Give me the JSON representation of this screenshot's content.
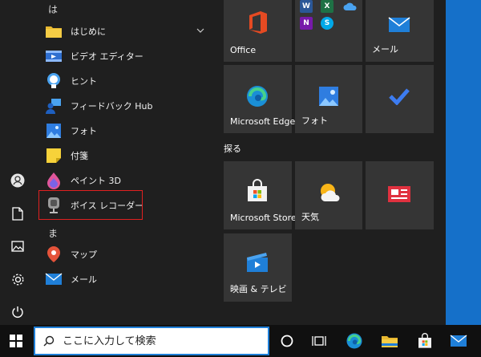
{
  "start_menu": {
    "app_list": {
      "sections": [
        {
          "letter": "は",
          "items": [
            {
              "label": "はじめに",
              "icon": "folder-icon"
            },
            {
              "label": "ビデオ エディター",
              "icon": "video-editor-icon"
            },
            {
              "label": "ヒント",
              "icon": "lightbulb-icon"
            },
            {
              "label": "フィードバック Hub",
              "icon": "feedback-hub-icon"
            },
            {
              "label": "フォト",
              "icon": "photos-icon"
            },
            {
              "label": "付箋",
              "icon": "sticky-notes-icon"
            },
            {
              "label": "ペイント 3D",
              "icon": "paint-3d-icon"
            },
            {
              "label": "ボイス レコーダー",
              "icon": "microphone-icon"
            }
          ]
        },
        {
          "letter": "ま",
          "items": [
            {
              "label": "マップ",
              "icon": "map-pin-icon"
            },
            {
              "label": "メール",
              "icon": "mail-icon"
            }
          ]
        }
      ],
      "highlighted_item": "ボイス レコーダー"
    },
    "rail": [
      "user-icon",
      "documents-icon",
      "pictures-icon",
      "settings-icon",
      "power-icon"
    ],
    "tiles": {
      "office": "Office",
      "mail": "メール",
      "edge": "Microsoft Edge",
      "photos": "フォト",
      "group_explore": "探る",
      "store": "Microsoft Store",
      "weather": "天気",
      "movies": "映画 & テレビ"
    },
    "office_mini_apps": [
      "W",
      "X",
      "N",
      "S"
    ]
  },
  "taskbar": {
    "search_placeholder": "ここに入力して検索",
    "buttons": [
      "windows-start-icon",
      "search-icon",
      "cortana-icon",
      "task-view-icon",
      "edge-icon",
      "file-explorer-icon",
      "store-icon",
      "mail-icon"
    ]
  },
  "colors": {
    "accent": "#1f7fd8",
    "desktop": "#1570c9",
    "highlight_border": "#e02020",
    "tile": "#353535",
    "menu_bg": "#1f1f1f"
  }
}
